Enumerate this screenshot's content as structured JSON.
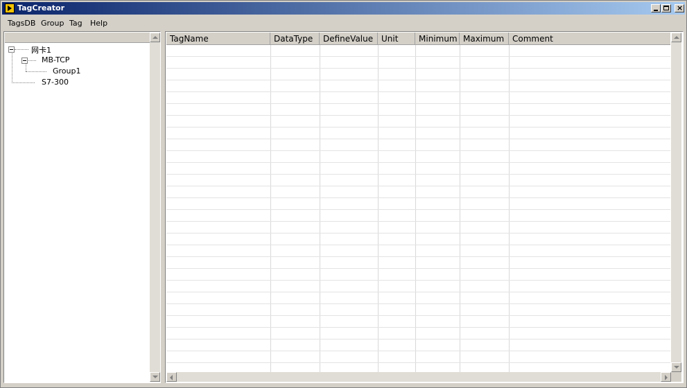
{
  "window": {
    "title": "TagCreator"
  },
  "menu": [
    "TagsDB",
    "Group",
    "Tag",
    "Help"
  ],
  "tree": [
    {
      "label": "网卡1"
    },
    {
      "label": "MB-TCP"
    },
    {
      "label": "Group1"
    },
    {
      "label": "S7-300"
    }
  ],
  "grid": {
    "columns": [
      "TagName",
      "DataType",
      "DefineValue",
      "Unit",
      "Minimum",
      "Maximum",
      "Comment"
    ],
    "row_count": 28
  },
  "colors": {
    "titlebar_start": "#0a246a",
    "titlebar_end": "#a6caf0",
    "face": "#d4d0c8"
  }
}
